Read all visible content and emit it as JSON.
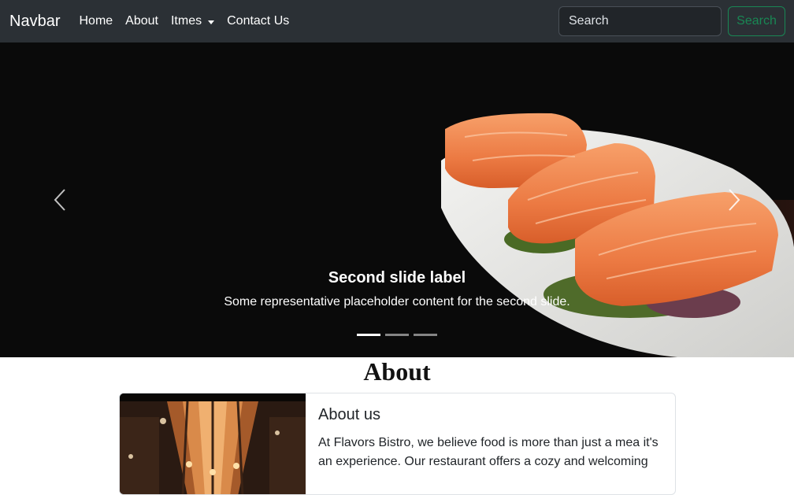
{
  "navbar": {
    "brand": "Navbar",
    "links": [
      {
        "label": "Home"
      },
      {
        "label": "About"
      },
      {
        "label": "Itmes"
      },
      {
        "label": "Contact Us"
      }
    ],
    "search": {
      "placeholder": "Search",
      "button_label": "Search"
    },
    "accent_color": "#198754"
  },
  "carousel": {
    "slide": {
      "title": "Second slide label",
      "text": "Some representative placeholder content for the second slide."
    },
    "indicators": 3,
    "active_indicator": 1,
    "icons": {
      "prev": "chevron-left-icon",
      "next": "chevron-right-icon"
    }
  },
  "about": {
    "heading": "About",
    "card": {
      "title": "About us",
      "text": "At Flavors Bistro, we believe food is more than just a mea it's an experience. Our restaurant offers a cozy and welcoming"
    }
  }
}
